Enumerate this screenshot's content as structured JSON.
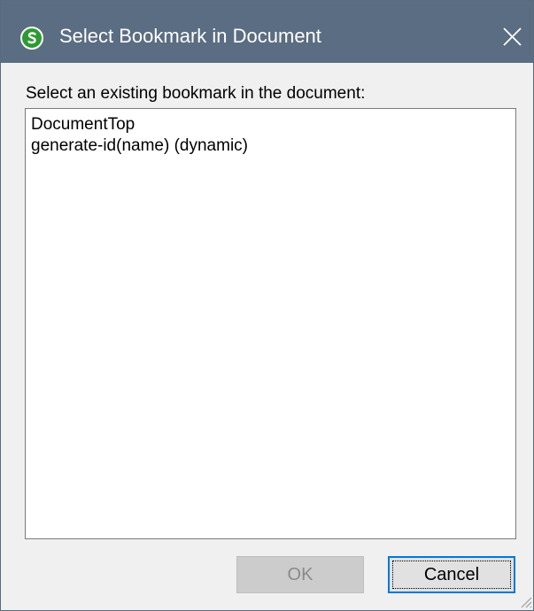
{
  "window": {
    "title": "Select Bookmark in Document",
    "app_icon": "altova-stylevision-icon",
    "close_icon": "close-icon"
  },
  "prompt": "Select an existing bookmark in the document:",
  "bookmarks": [
    "DocumentTop",
    "generate-id(name) (dynamic)"
  ],
  "buttons": {
    "ok_label": "OK",
    "ok_enabled": false,
    "cancel_label": "Cancel"
  },
  "colors": {
    "titlebar": "#5b6d82",
    "app_icon": "#2e9a33",
    "focus_border": "#0078d7"
  }
}
